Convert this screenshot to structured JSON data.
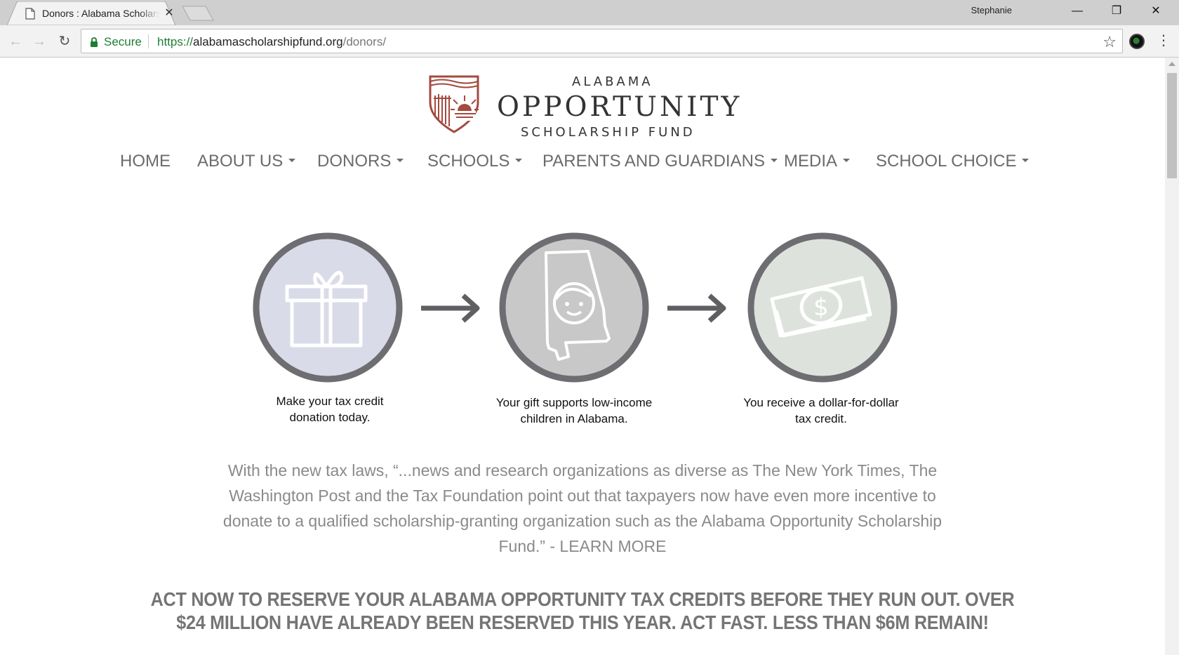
{
  "browser": {
    "tab_title": "Donors : Alabama Scholarship Fund",
    "profile_name": "Stephanie",
    "secure_label": "Secure",
    "url_scheme": "https://",
    "url_host": "alabamascholarshipfund.org",
    "url_path": "/donors/"
  },
  "logo": {
    "line1": "ALABAMA",
    "line2": "OPPORTUNITY",
    "line3": "SCHOLARSHIP FUND",
    "brand_color": "#a44a3f"
  },
  "nav": {
    "items": [
      {
        "label": "HOME"
      },
      {
        "label": "ABOUT US"
      },
      {
        "label": "DONORS"
      },
      {
        "label": "SCHOOLS"
      },
      {
        "label": "PARENTS AND GUARDIANS"
      },
      {
        "label": "MEDIA"
      },
      {
        "label": "SCHOOL CHOICE"
      }
    ]
  },
  "steps": [
    {
      "icon": "gift-icon",
      "caption_line1": "Make your tax credit",
      "caption_line2": "donation today.",
      "fill": "#dadbe8"
    },
    {
      "icon": "alabama-child-icon",
      "caption_line1": "Your gift supports low-income",
      "caption_line2": "children in Alabama.",
      "fill": "#c8c8c8"
    },
    {
      "icon": "money-icon",
      "caption_line1": "You receive a dollar-for-dollar",
      "caption_line2": "tax credit.",
      "fill": "#dde3dc"
    }
  ],
  "content": {
    "paragraph": "With the new tax laws, “...news and research organizations as diverse as The New York Times, The Washington Post and the Tax Foundation point out that taxpayers now have even more incentive to donate to a qualified scholarship-granting organization such as the Alabama Opportunity Scholarship Fund.” - ",
    "learn_more": "LEARN MORE",
    "cta": "ACT NOW TO RESERVE YOUR ALABAMA OPPORTUNITY TAX CREDITS BEFORE THEY RUN OUT. OVER $24 MILLION HAVE ALREADY BEEN RESERVED THIS YEAR. ACT FAST. LESS THAN $6M REMAIN!"
  }
}
